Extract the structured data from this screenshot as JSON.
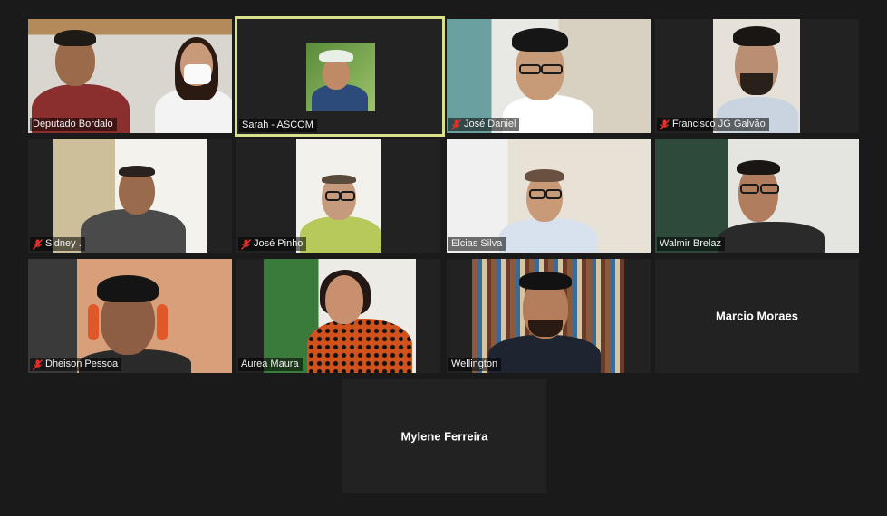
{
  "participants": [
    {
      "name": "Deputado Bordalo",
      "muted": false
    },
    {
      "name": "Sarah - ASCOM",
      "muted": false,
      "active_speaker": true
    },
    {
      "name": "José Daniel",
      "muted": true
    },
    {
      "name": "Francisco JG Galvão",
      "muted": true
    },
    {
      "name": "Sidney .",
      "muted": true
    },
    {
      "name": "José Pinho",
      "muted": true
    },
    {
      "name": "Elcias Silva",
      "muted": false
    },
    {
      "name": "Walmir Brelaz",
      "muted": false
    },
    {
      "name": "Dheison Pessoa",
      "muted": true
    },
    {
      "name": "Aurea Maura",
      "muted": false
    },
    {
      "name": "Wellington",
      "muted": false
    },
    {
      "name": "Marcio Moraes",
      "muted": false,
      "video_off": true
    },
    {
      "name": "Mylene Ferreira",
      "muted": false,
      "video_off": true
    }
  ],
  "colors": {
    "background": "#1a1a1a",
    "tile": "#222222",
    "active_border": "#d8e08a",
    "muted_icon": "#e0312b"
  }
}
